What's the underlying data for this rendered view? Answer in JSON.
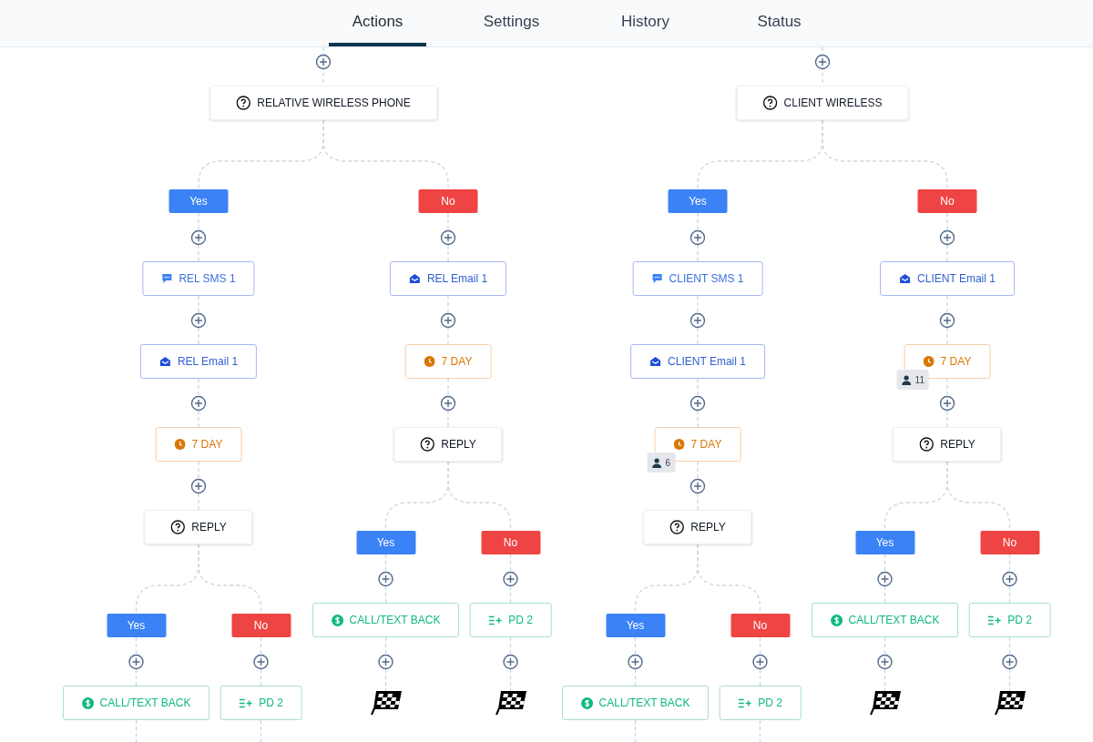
{
  "tabs": [
    {
      "label": "Actions",
      "selected": true
    },
    {
      "label": "Settings",
      "selected": false
    },
    {
      "label": "History",
      "selected": false
    },
    {
      "label": "Status",
      "selected": false
    }
  ],
  "flows": [
    {
      "steps": [
        {
          "kind": "condition",
          "label": "RELATIVE WIRELESS PHONE",
          "branches": [
            {
              "kind": "yes",
              "label": "Yes",
              "steps": [
                {
                  "kind": "sms",
                  "label": "REL SMS 1"
                },
                {
                  "kind": "email",
                  "label": "REL Email 1"
                },
                {
                  "kind": "wait",
                  "label": "7 DAY"
                },
                {
                  "kind": "condition",
                  "label": "REPLY",
                  "branches": [
                    {
                      "kind": "yes",
                      "label": "Yes",
                      "steps": [
                        {
                          "kind": "call",
                          "label": "CALL/TEXT BACK"
                        }
                      ]
                    },
                    {
                      "kind": "no",
                      "label": "No",
                      "steps": [
                        {
                          "kind": "list",
                          "label": "PD 2"
                        }
                      ]
                    }
                  ]
                }
              ]
            },
            {
              "kind": "no",
              "label": "No",
              "steps": [
                {
                  "kind": "email",
                  "label": "REL Email 1"
                },
                {
                  "kind": "wait",
                  "label": "7 DAY"
                },
                {
                  "kind": "condition",
                  "label": "REPLY",
                  "branches": [
                    {
                      "kind": "yes",
                      "label": "Yes",
                      "steps": [
                        {
                          "kind": "call",
                          "label": "CALL/TEXT BACK"
                        },
                        {
                          "kind": "finish"
                        }
                      ]
                    },
                    {
                      "kind": "no",
                      "label": "No",
                      "steps": [
                        {
                          "kind": "list",
                          "label": "PD 2"
                        },
                        {
                          "kind": "finish"
                        }
                      ]
                    }
                  ]
                }
              ]
            }
          ]
        }
      ]
    },
    {
      "steps": [
        {
          "kind": "condition",
          "label": "CLIENT WIRELESS",
          "branches": [
            {
              "kind": "yes",
              "label": "Yes",
              "steps": [
                {
                  "kind": "sms",
                  "label": "CLIENT SMS 1"
                },
                {
                  "kind": "email",
                  "label": "CLIENT Email 1"
                },
                {
                  "kind": "wait",
                  "label": "7 DAY",
                  "contacts": "6"
                },
                {
                  "kind": "condition",
                  "label": "REPLY",
                  "branches": [
                    {
                      "kind": "yes",
                      "label": "Yes",
                      "steps": [
                        {
                          "kind": "call",
                          "label": "CALL/TEXT BACK"
                        }
                      ]
                    },
                    {
                      "kind": "no",
                      "label": "No",
                      "steps": [
                        {
                          "kind": "list",
                          "label": "PD 2"
                        }
                      ]
                    }
                  ]
                }
              ]
            },
            {
              "kind": "no",
              "label": "No",
              "steps": [
                {
                  "kind": "email",
                  "label": "CLIENT Email 1"
                },
                {
                  "kind": "wait",
                  "label": "7 DAY",
                  "contacts": "11"
                },
                {
                  "kind": "condition",
                  "label": "REPLY",
                  "branches": [
                    {
                      "kind": "yes",
                      "label": "Yes",
                      "steps": [
                        {
                          "kind": "call",
                          "label": "CALL/TEXT BACK"
                        },
                        {
                          "kind": "finish"
                        }
                      ]
                    },
                    {
                      "kind": "no",
                      "label": "No",
                      "steps": [
                        {
                          "kind": "list",
                          "label": "PD 2"
                        },
                        {
                          "kind": "finish"
                        }
                      ]
                    }
                  ]
                }
              ]
            }
          ]
        }
      ]
    }
  ]
}
